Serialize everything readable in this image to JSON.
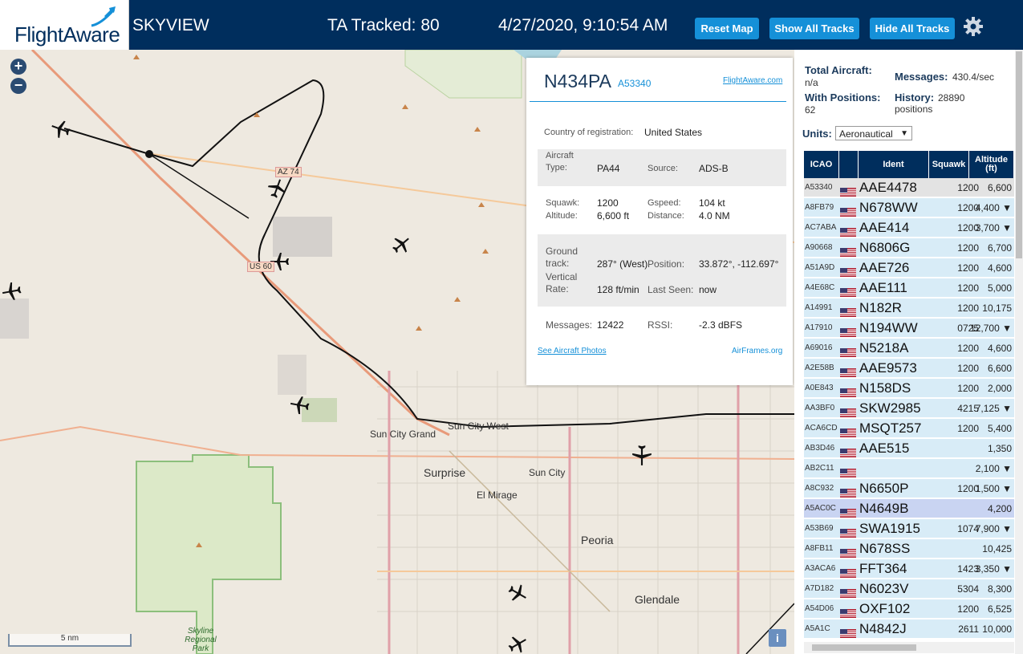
{
  "header": {
    "logo_text": "FlightAware",
    "title": "SKYVIEW",
    "tracked": "TA Tracked: 80",
    "datetime": "4/27/2020, 9:10:54 AM",
    "buttons": {
      "reset": "Reset Map",
      "show_all": "Show All Tracks",
      "hide_all": "Hide All Tracks"
    }
  },
  "map": {
    "zoom_in": "+",
    "zoom_out": "−",
    "scale": "5 nm",
    "info": "i",
    "labels": {
      "sun_city_grand": "Sun City Grand",
      "sun_city_west": "Sun City West",
      "surprise": "Surprise",
      "sun_city": "Sun City",
      "el_mirage": "El Mirage",
      "peoria": "Peoria",
      "glendale": "Glendale",
      "skyline": "Skyline Regional Park",
      "az74": "AZ 74",
      "us60": "US 60"
    }
  },
  "popup": {
    "ident": "N434PA",
    "hex": "A53340",
    "fa_link": "FlightAware.com",
    "country_label": "Country of registration:",
    "country": "United States",
    "aircraft_type_label": "Aircraft Type:",
    "aircraft_type": "PA44",
    "source_label": "Source:",
    "source": "ADS-B",
    "squawk_label": "Squawk:",
    "squawk": "1200",
    "gspeed_label": "Gspeed:",
    "gspeed": "104 kt",
    "altitude_label": "Altitude:",
    "altitude": "6,600 ft",
    "distance_label": "Distance:",
    "distance": "4.0 NM",
    "ground_track_label": "Ground track:",
    "ground_track": "287° (West)",
    "position_label": "Position:",
    "position": "33.872°, -112.697°",
    "vrate_label": "Vertical Rate:",
    "vrate": "128 ft/min",
    "last_seen_label": "Last Seen:",
    "last_seen": "now",
    "messages_label": "Messages:",
    "messages": "12422",
    "rssi_label": "RSSI:",
    "rssi": "-2.3 dBFS",
    "photos_link": "See Aircraft Photos",
    "airframes_link": "AirFrames.org"
  },
  "stats": {
    "total_label": "Total Aircraft:",
    "total": "n/a",
    "messages_label": "Messages:",
    "messages": "430.4/sec",
    "positions_label": "With Positions:",
    "positions": "62",
    "history_label": "History:",
    "history": "28890 positions",
    "units_label": "Units:",
    "units_value": "Aeronautical"
  },
  "table": {
    "headers": {
      "icao": "ICAO",
      "ident": "Ident",
      "squawk": "Squawk",
      "altitude": "Altitude (ft)"
    },
    "rows": [
      {
        "icao": "A53340",
        "ident": "AAE4478",
        "squawk": "1200",
        "alt": "6,600"
      },
      {
        "icao": "A8FB79",
        "ident": "N678WW",
        "squawk": "1200",
        "alt": "4,400 ▼"
      },
      {
        "icao": "AC7ABA",
        "ident": "AAE414",
        "squawk": "1200",
        "alt": "3,700 ▼"
      },
      {
        "icao": "A90668",
        "ident": "N6806G",
        "squawk": "1200",
        "alt": "6,700"
      },
      {
        "icao": "A51A9D",
        "ident": "AAE726",
        "squawk": "1200",
        "alt": "4,600"
      },
      {
        "icao": "A4E68C",
        "ident": "AAE111",
        "squawk": "1200",
        "alt": "5,000"
      },
      {
        "icao": "A14991",
        "ident": "N182R",
        "squawk": "1200",
        "alt": "10,175"
      },
      {
        "icao": "A17910",
        "ident": "N194WW",
        "squawk": "0725",
        "alt": "12,700 ▼"
      },
      {
        "icao": "A69016",
        "ident": "N5218A",
        "squawk": "1200",
        "alt": "4,600"
      },
      {
        "icao": "A2E58B",
        "ident": "AAE9573",
        "squawk": "1200",
        "alt": "6,600"
      },
      {
        "icao": "A0E843",
        "ident": "N158DS",
        "squawk": "1200",
        "alt": "2,000"
      },
      {
        "icao": "AA3BF0",
        "ident": "SKW2985",
        "squawk": "4215",
        "alt": "7,125 ▼"
      },
      {
        "icao": "ACA6CD",
        "ident": "MSQT257",
        "squawk": "1200",
        "alt": "5,400"
      },
      {
        "icao": "AB3D46",
        "ident": "AAE515",
        "squawk": "",
        "alt": "1,350"
      },
      {
        "icao": "AB2C11",
        "ident": "",
        "squawk": "",
        "alt": "2,100 ▼"
      },
      {
        "icao": "A8C932",
        "ident": "N6650P",
        "squawk": "1200",
        "alt": "1,500 ▼"
      },
      {
        "icao": "A5AC0C",
        "ident": "N4649B",
        "squawk": "",
        "alt": "4,200"
      },
      {
        "icao": "A53B69",
        "ident": "SWA1915",
        "squawk": "1074",
        "alt": "7,900 ▼"
      },
      {
        "icao": "A8FB11",
        "ident": "N678SS",
        "squawk": "",
        "alt": "10,425"
      },
      {
        "icao": "A3ACA6",
        "ident": "FFT364",
        "squawk": "1423",
        "alt": "3,350 ▼"
      },
      {
        "icao": "A7D182",
        "ident": "N6023V",
        "squawk": "5304",
        "alt": "8,300"
      },
      {
        "icao": "A54D06",
        "ident": "OXF102",
        "squawk": "1200",
        "alt": "6,525"
      },
      {
        "icao": "A5A1C",
        "ident": "N4842J",
        "squawk": "2611",
        "alt": "10,000"
      }
    ]
  },
  "colors": {
    "header_bg": "#002e5d",
    "button_bg": "#1590d8",
    "row_bg": "#d8ecf7",
    "selected_row": "#e3e3e3",
    "highlight_row": "#c9d4f2"
  }
}
